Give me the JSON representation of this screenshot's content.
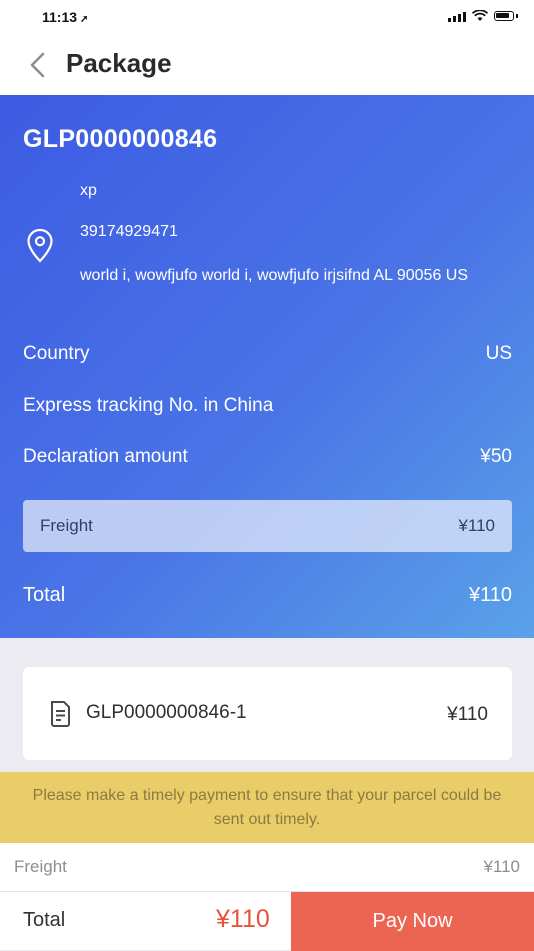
{
  "status_bar": {
    "time": "11:13"
  },
  "nav": {
    "title": "Package"
  },
  "package": {
    "id": "GLP0000000846",
    "address": {
      "name": "xp",
      "phone": "39174929471",
      "line": "world i, wowfjufo world i, wowfjufo irjsifnd AL 90056 US"
    },
    "country": {
      "label": "Country",
      "value": "US"
    },
    "express": {
      "label": "Express tracking No. in China",
      "value": ""
    },
    "declaration": {
      "label": "Declaration amount",
      "value": "¥50"
    },
    "freight": {
      "label": "Freight",
      "value": "¥110"
    },
    "total": {
      "label": "Total",
      "value": "¥110"
    }
  },
  "sub_package": {
    "id": "GLP0000000846-1",
    "amount": "¥110"
  },
  "notice": {
    "text": "Please make a timely payment to ensure that your parcel could be sent out timely."
  },
  "summary": {
    "freight_label": "Freight",
    "freight_value": "¥110"
  },
  "bottom_bar": {
    "total_label": "Total",
    "total_amount": "¥110",
    "pay_label": "Pay Now"
  },
  "colors": {
    "hero_start": "#3c5be3",
    "hero_end": "#5aa2e8",
    "notice_bg": "#e9cd68",
    "pay_button": "#ec6553",
    "amount_red": "#e8513a"
  }
}
